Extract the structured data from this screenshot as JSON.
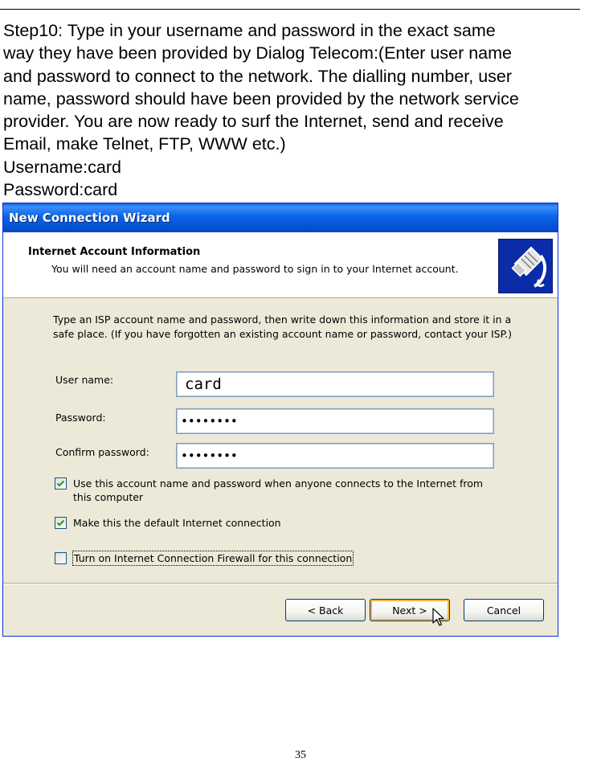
{
  "instructions": {
    "lines": [
      "Step10: Type in your username and password in the exact same",
      "way they have been provided by Dialog Telecom:(Enter user name",
      "and password to connect to the network. The dialling number, user",
      "name, password should have been provided by the network service",
      "provider. You are now ready to surf the Internet, send and receive",
      "Email, make Telnet, FTP, WWW etc.)",
      "Username:card",
      "Password:card"
    ]
  },
  "dialog": {
    "title": "New Connection Wizard",
    "header_title": "Internet Account Information",
    "header_subtitle": "You will need an account name and password to sign in to your Internet account.",
    "header_icon": "network-cable-icon",
    "body_lines": [
      "Type an ISP account name and password, then write down this information and store it in a",
      "safe place. (If you have forgotten an existing account name or password, contact your ISP.)"
    ],
    "fields": {
      "username_label": "User name:",
      "username_value": "card",
      "password_label": "Password:",
      "password_value": "••••••••",
      "confirm_label": "Confirm password:",
      "confirm_value": "••••••••"
    },
    "checkboxes": [
      {
        "label_lines": [
          "Use this account  name and password when anyone connects to the Internet from",
          "this computer"
        ],
        "checked": true
      },
      {
        "label_lines": [
          "Make this the default Internet connection"
        ],
        "checked": true
      },
      {
        "label_lines": [
          "Turn on Internet Connection Firewall for this connection"
        ],
        "checked": false
      }
    ],
    "buttons": {
      "back": "< Back",
      "next": "Next >",
      "cancel": "Cancel"
    },
    "colors": {
      "titlebar": "#0a5ee8",
      "dialog_bg": "#ece9d8",
      "check_mark": "#21a121",
      "default_button_glow": "#f8b33a"
    }
  },
  "page_number": "35"
}
